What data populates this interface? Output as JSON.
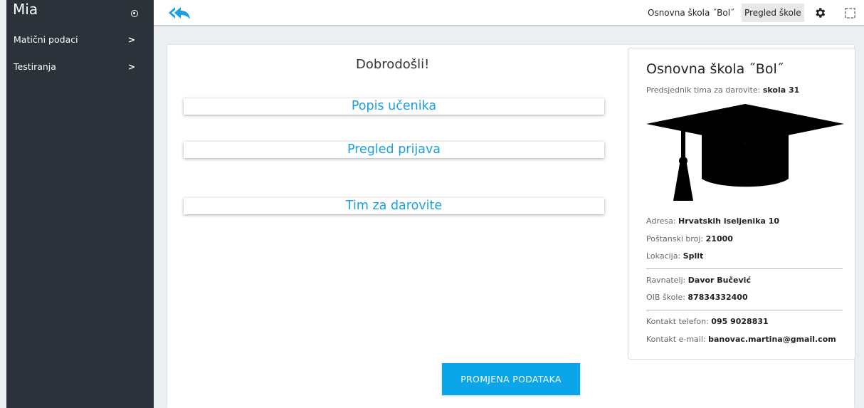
{
  "sidebar": {
    "brand": "Mia",
    "items": [
      {
        "label": "Matični podaci"
      },
      {
        "label": "Testiranja"
      }
    ]
  },
  "topbar": {
    "school_name": "Osnovna škola ˝Bol˝",
    "view_label": "Pregled škole"
  },
  "main": {
    "welcome": "Dobrodošli!",
    "links": [
      "Popis učenika",
      "Pregled prijava",
      "Tim za darovite"
    ],
    "change_button": "PROMJENA PODATAKA"
  },
  "school": {
    "title": "Osnovna škola ˝Bol˝",
    "president_label": "Predsjednik tima za darovite:",
    "president_value": "skola 31",
    "address_label": "Adresa:",
    "address_value": "Hrvatskih iseljenika 10",
    "postal_label": "Poštanski broj:",
    "postal_value": "21000",
    "location_label": "Lokacija:",
    "location_value": "Split",
    "principal_label": "Ravnatelj:",
    "principal_value": "Davor Bučević",
    "oib_label": "OIB škole:",
    "oib_value": "87834332400",
    "phone_label": "Kontakt telefon:",
    "phone_value": "095 9028831",
    "email_label": "Kontakt e-mail:",
    "email_value": "banovac.martina@gmail.com"
  },
  "icons": {
    "back": "reply-all-icon",
    "settings": "gear-icon",
    "fullscreen": "fullscreen-icon",
    "school_logo": "graduation-cap-icon"
  },
  "colors": {
    "sidebar_bg": "#2b323a",
    "accent": "#0ba5ea",
    "link": "#1a9fe0"
  }
}
